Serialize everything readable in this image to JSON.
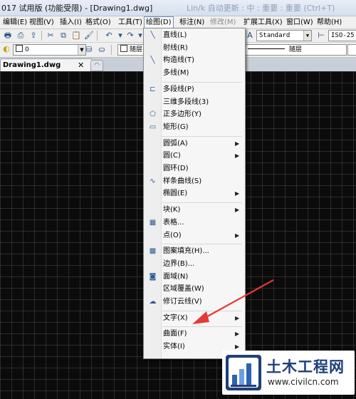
{
  "window": {
    "title": "017 试用版 (功能受限) - [Drawing1.dwg]",
    "title_faint": "Lin/k 自动更新 : 中 : 重要 : 重要 (Ctrl+T)"
  },
  "menubar": {
    "items": [
      {
        "label": "编辑(E)",
        "active": false,
        "disabled": false
      },
      {
        "label": "视图(V)",
        "active": false,
        "disabled": false
      },
      {
        "label": "插入(I)",
        "active": false,
        "disabled": false
      },
      {
        "label": "格式(O)",
        "active": false,
        "disabled": false
      },
      {
        "label": "工具(T)",
        "active": false,
        "disabled": false
      },
      {
        "label": "绘图(D)",
        "active": true,
        "disabled": false
      },
      {
        "label": "标注(N)",
        "active": false,
        "disabled": false
      },
      {
        "label": "修改(M)",
        "active": false,
        "disabled": true
      },
      {
        "label": "扩展工具(X)",
        "active": false,
        "disabled": false
      },
      {
        "label": "窗口(W)",
        "active": false,
        "disabled": false
      },
      {
        "label": "帮助(H)",
        "active": false,
        "disabled": false
      }
    ]
  },
  "toolbar": {
    "text_style": "Standard",
    "dim_style": "ISO-25",
    "layer": "0",
    "color": "随层",
    "linetype": "随层"
  },
  "tabs": {
    "doc": "Drawing1.dwg",
    "close_symbol": "✕"
  },
  "draw_menu": {
    "items": [
      {
        "label": "直线(L)",
        "icon": "line-icon",
        "glyph": "╲",
        "submenu": false
      },
      {
        "label": "射线(R)",
        "icon": "",
        "glyph": "",
        "submenu": false
      },
      {
        "label": "构造线(T)",
        "icon": "xline-icon",
        "glyph": "╲",
        "submenu": false
      },
      {
        "label": "多线(M)",
        "icon": "",
        "glyph": "",
        "submenu": false
      },
      {
        "sep": true
      },
      {
        "label": "多段线(P)",
        "icon": "polyline-icon",
        "glyph": "⊏",
        "submenu": false
      },
      {
        "label": "三维多段线(3)",
        "icon": "",
        "glyph": "",
        "submenu": false
      },
      {
        "label": "正多边形(Y)",
        "icon": "polygon-icon",
        "glyph": "⬠",
        "submenu": false
      },
      {
        "label": "矩形(G)",
        "icon": "rectangle-icon",
        "glyph": "▭",
        "submenu": false
      },
      {
        "sep": true
      },
      {
        "label": "圆弧(A)",
        "icon": "",
        "glyph": "",
        "submenu": true
      },
      {
        "label": "圆(C)",
        "icon": "",
        "glyph": "",
        "submenu": true
      },
      {
        "label": "圆环(D)",
        "icon": "",
        "glyph": "",
        "submenu": false
      },
      {
        "label": "样条曲线(S)",
        "icon": "spline-icon",
        "glyph": "∿",
        "submenu": false
      },
      {
        "label": "椭圆(E)",
        "icon": "",
        "glyph": "",
        "submenu": true
      },
      {
        "sep": true
      },
      {
        "label": "块(K)",
        "icon": "",
        "glyph": "",
        "submenu": true
      },
      {
        "label": "表格...",
        "icon": "table-icon",
        "glyph": "▦",
        "submenu": false
      },
      {
        "label": "点(O)",
        "icon": "",
        "glyph": "",
        "submenu": true
      },
      {
        "sep": true
      },
      {
        "label": "图案填充(H)...",
        "icon": "hatch-icon",
        "glyph": "▩",
        "submenu": false
      },
      {
        "label": "边界(B)...",
        "icon": "",
        "glyph": "",
        "submenu": false
      },
      {
        "label": "面域(N)",
        "icon": "region-icon",
        "glyph": "◙",
        "submenu": false
      },
      {
        "label": "区域覆盖(W)",
        "icon": "",
        "glyph": "",
        "submenu": false
      },
      {
        "label": "修订云线(V)",
        "icon": "revcloud-icon",
        "glyph": "☁",
        "submenu": false
      },
      {
        "sep": true
      },
      {
        "label": "文字(X)",
        "icon": "",
        "glyph": "",
        "submenu": true
      },
      {
        "sep": true
      },
      {
        "label": "曲面(F)",
        "icon": "",
        "glyph": "",
        "submenu": true
      },
      {
        "label": "实体(I)",
        "icon": "",
        "glyph": "",
        "submenu": true
      }
    ],
    "submenu_arrow": "▶"
  },
  "annotation": {
    "color": "#e53935"
  },
  "watermark": {
    "title": "土木工程网",
    "url": "www.civilcn.com"
  }
}
